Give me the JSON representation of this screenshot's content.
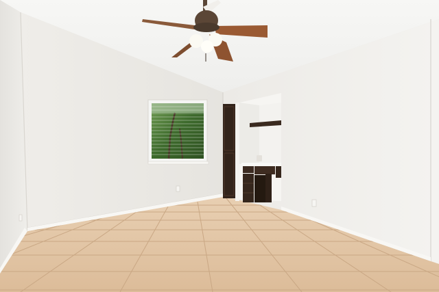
{
  "scene": {
    "type": "photo",
    "subject": "empty-bedroom",
    "colors": {
      "ceiling": "#f3f3f1",
      "left_wall": "#eceae6",
      "back_wall": "#e8e6e2",
      "right_wall": "#f0efec",
      "floor_tile": "#e3c6a6",
      "grout": "#cfae8b",
      "cabinet_wood": "#3b2a20",
      "fan_blade": "#9a5a33",
      "window_foliage": "#3f6b2e"
    }
  }
}
